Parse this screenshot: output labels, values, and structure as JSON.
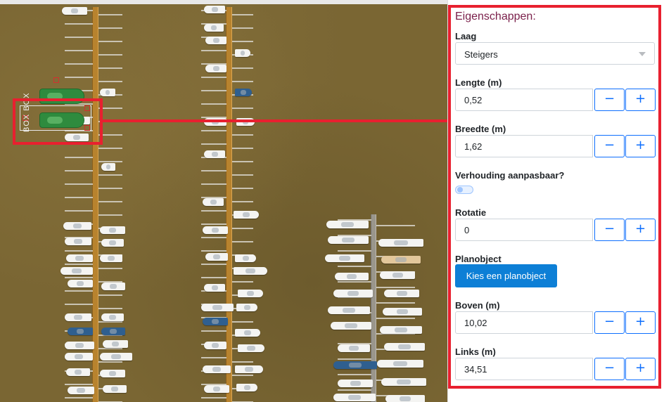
{
  "map": {
    "selected_object_label": "BOX BOX"
  },
  "panel": {
    "title": "Eigenschappen:",
    "layer": {
      "label": "Laag",
      "value": "Steigers"
    },
    "length": {
      "label": "Lengte (m)",
      "value": "0,52"
    },
    "width": {
      "label": "Breedte (m)",
      "value": "1,62"
    },
    "aspect": {
      "label": "Verhouding aanpasbaar?",
      "enabled": false
    },
    "rotation": {
      "label": "Rotatie",
      "value": "0"
    },
    "planobject": {
      "label": "Planobject",
      "button": "Kies een planobject"
    },
    "top": {
      "label": "Boven (m)",
      "value": "10,02"
    },
    "left": {
      "label": "Links (m)",
      "value": "34,51"
    },
    "minus_symbol": "−",
    "plus_symbol": "+"
  },
  "colors": {
    "highlight": "#e8202f",
    "accent": "#0d6efd",
    "primary_button": "#0d7fd6",
    "title": "#7a1f4a"
  }
}
